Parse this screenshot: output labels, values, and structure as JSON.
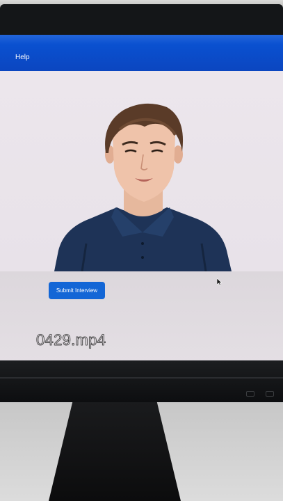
{
  "nav": {
    "help_label": "Help"
  },
  "actions": {
    "submit_label": "Submit Interview"
  },
  "overlay": {
    "filename": "0429.mp4"
  },
  "colors": {
    "topbar": "#0b4fcf",
    "button": "#1366d6",
    "screen_bg": "#e7e1e6"
  },
  "icons": [
    "mouse-cursor-icon"
  ]
}
